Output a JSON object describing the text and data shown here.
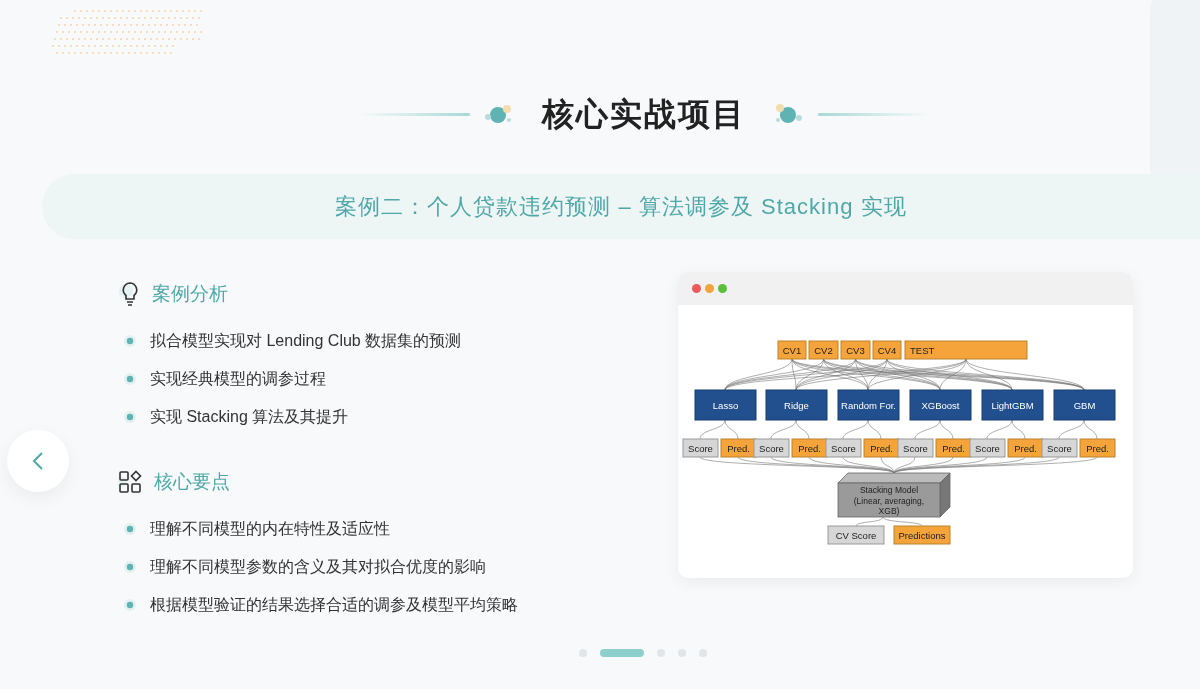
{
  "title": "核心实战项目",
  "subtitle": "案例二：个人贷款违约预测 – 算法调参及 Stacking 实现",
  "sections": [
    {
      "kind": "bulb",
      "heading": "案例分析",
      "items": [
        "拟合模型实现对 Lending Club 数据集的预测",
        "实现经典模型的调参过程",
        "实现 Stacking 算法及其提升"
      ]
    },
    {
      "kind": "apps",
      "heading": "核心要点",
      "items": [
        "理解不同模型的内在特性及适应性",
        "理解不同模型参数的含义及其对拟合优度的影响",
        "根据模型验证的结果选择合适的调参及模型平均策略"
      ]
    }
  ],
  "diagram": {
    "folds": [
      {
        "label": "CV1",
        "kind": "cv"
      },
      {
        "label": "CV2",
        "kind": "cv"
      },
      {
        "label": "CV3",
        "kind": "cv"
      },
      {
        "label": "CV4",
        "kind": "cv"
      },
      {
        "label": "TEST",
        "kind": "test"
      }
    ],
    "models": [
      "Lasso",
      "Ridge",
      "Random For.",
      "XGBoost",
      "LightGBM",
      "GBM"
    ],
    "outputs": [
      {
        "label": "Score",
        "kind": "score"
      },
      {
        "label": "Pred.",
        "kind": "pred"
      },
      {
        "label": "Score",
        "kind": "score"
      },
      {
        "label": "Pred.",
        "kind": "pred"
      },
      {
        "label": "Score",
        "kind": "score"
      },
      {
        "label": "Pred.",
        "kind": "pred"
      },
      {
        "label": "Score",
        "kind": "score"
      },
      {
        "label": "Pred.",
        "kind": "pred"
      },
      {
        "label": "Score",
        "kind": "score"
      },
      {
        "label": "Pred.",
        "kind": "pred"
      },
      {
        "label": "Score",
        "kind": "score"
      },
      {
        "label": "Pred.",
        "kind": "pred"
      }
    ],
    "stacker": [
      "Stacking Model",
      "(Linear, averaging,",
      "XGB)"
    ],
    "final": [
      {
        "label": "CV Score",
        "kind": "score"
      },
      {
        "label": "Predictions",
        "kind": "pred"
      }
    ]
  },
  "pager": [
    {
      "selected": false
    },
    {
      "selected": true
    },
    {
      "selected": false
    },
    {
      "selected": false
    },
    {
      "selected": false
    }
  ]
}
